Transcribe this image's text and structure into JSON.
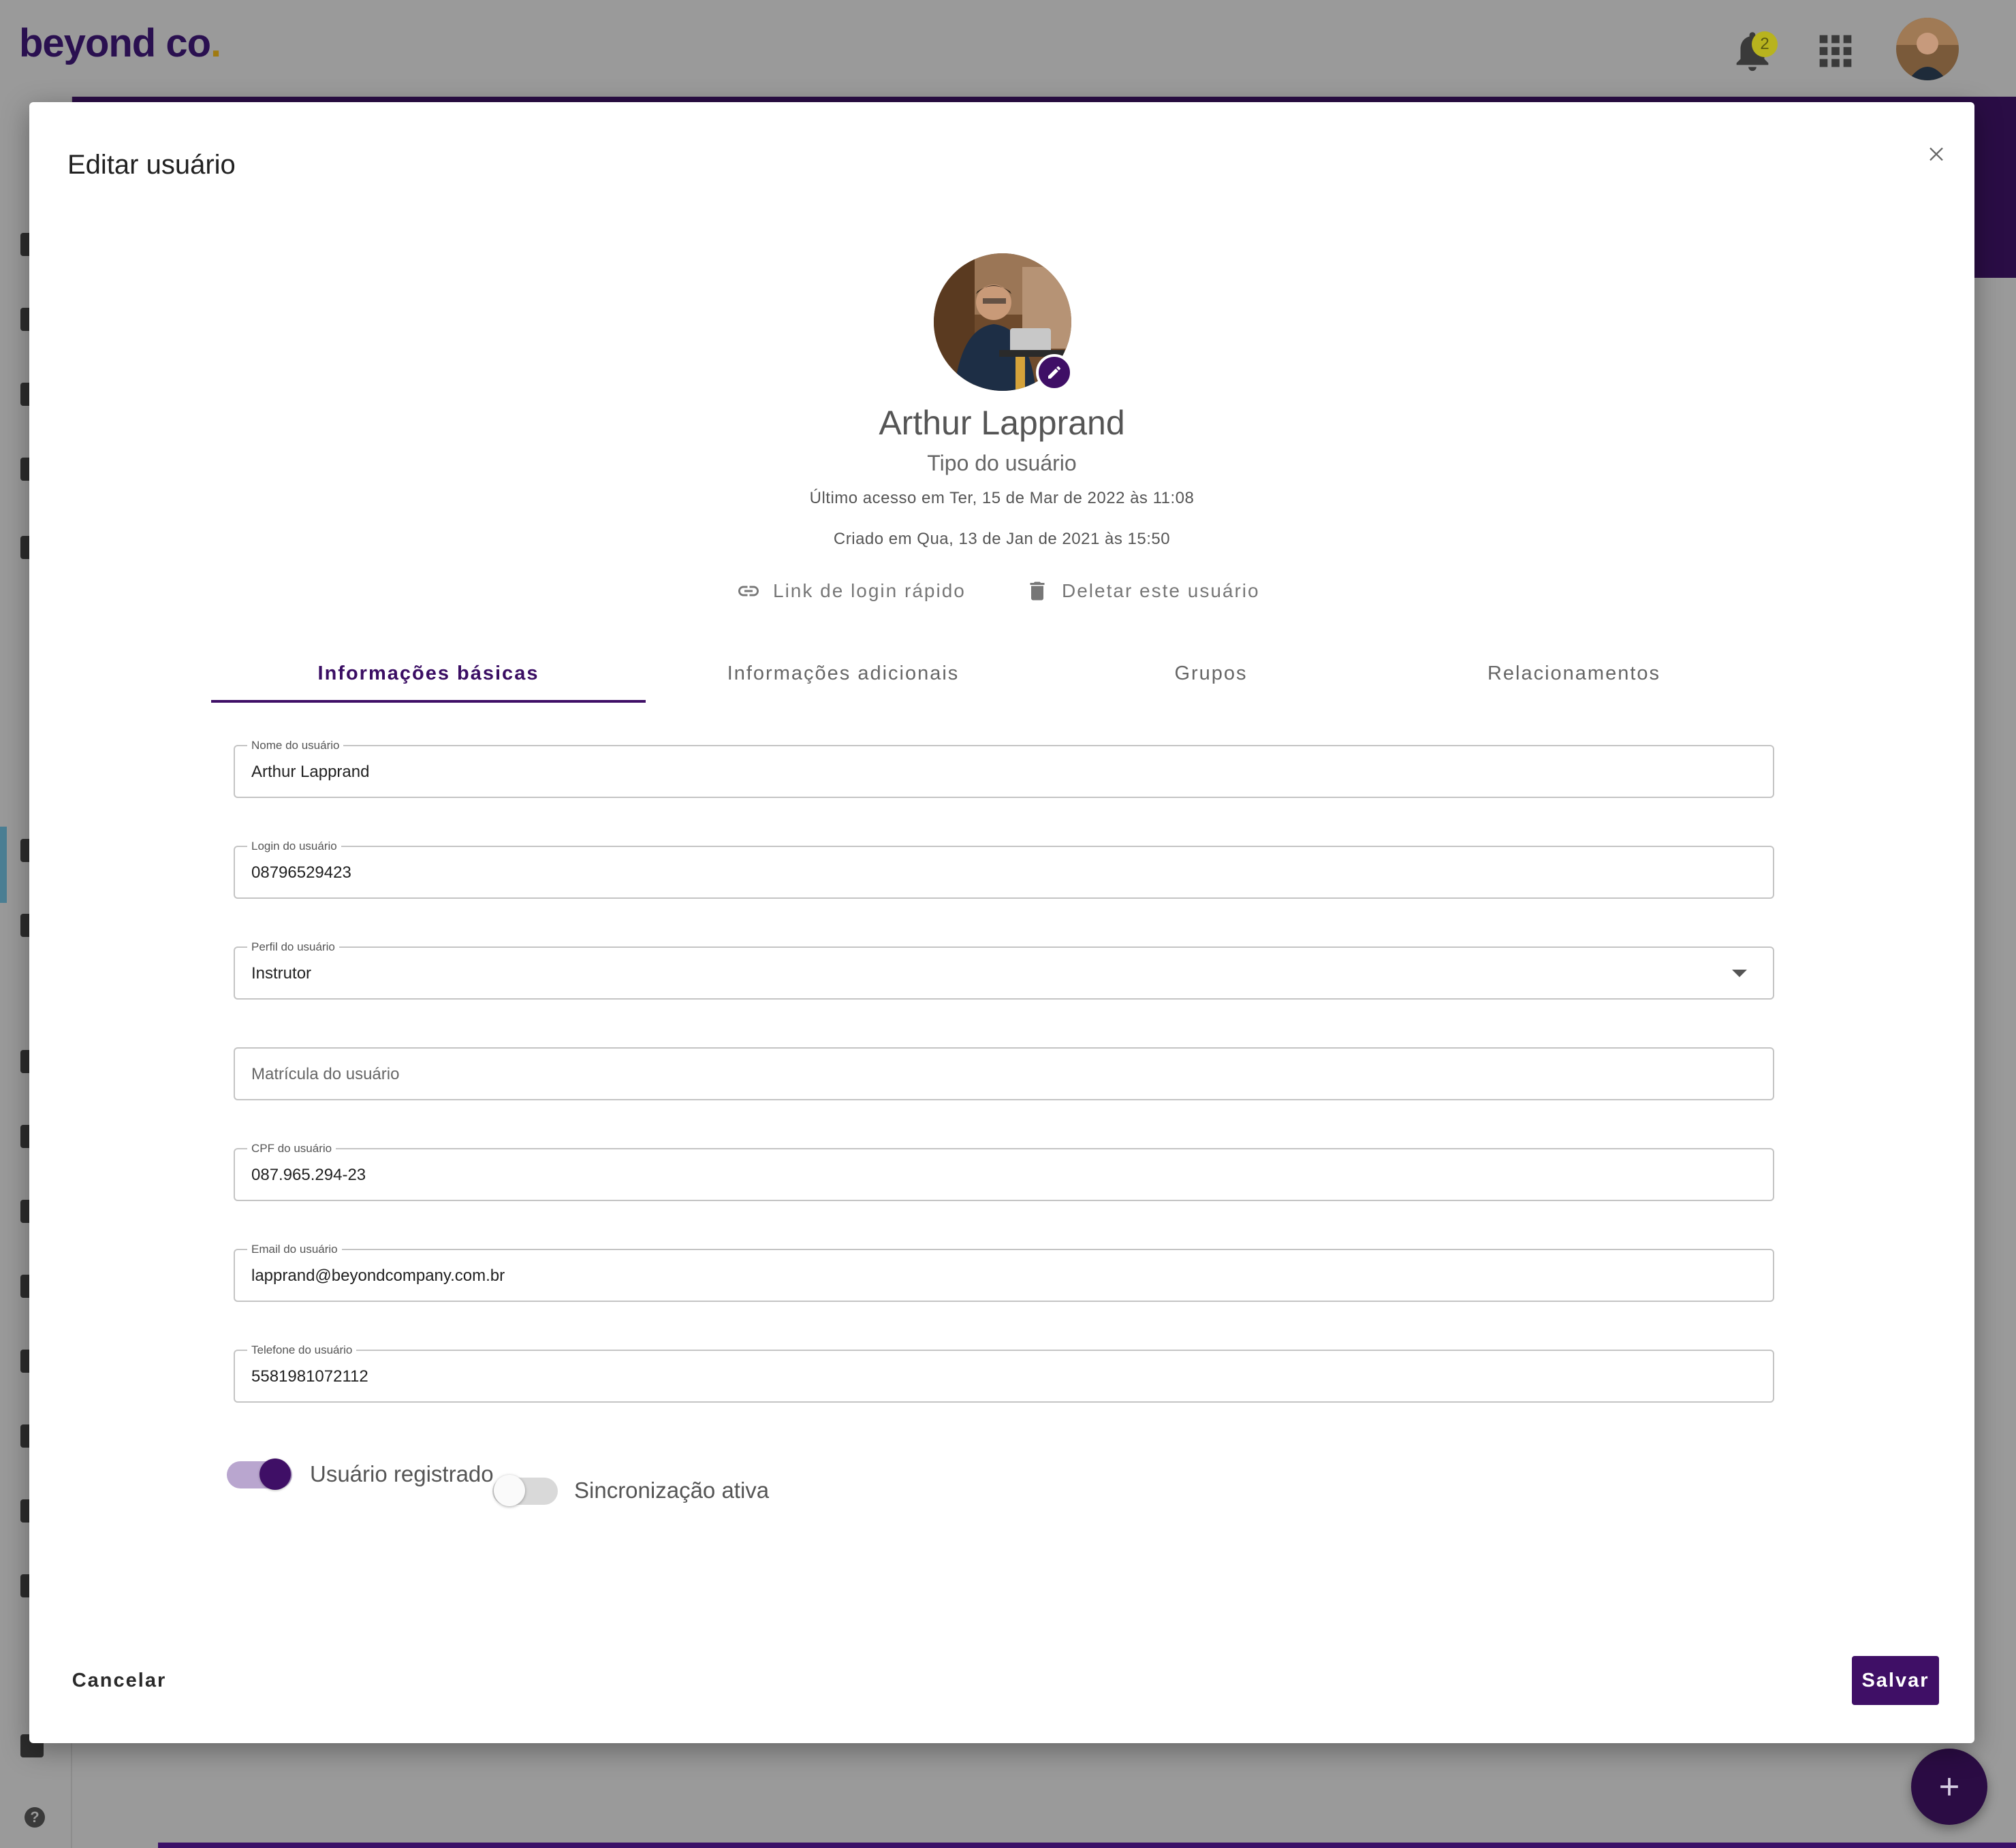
{
  "app": {
    "logo_text": "beyond co",
    "logo_dot": ".",
    "notifications_count": "2"
  },
  "modal": {
    "title": "Editar usuário",
    "user": {
      "name": "Arthur Lapprand",
      "type": "Tipo do usuário",
      "last_access": "Último acesso em Ter, 15 de Mar de 2022 às 11:08",
      "created": "Criado em Qua, 13 de Jan de 2021 às 15:50"
    },
    "actions": {
      "quick_login": "Link de login rápido",
      "delete_user": "Deletar este usuário"
    },
    "tabs": [
      {
        "label": "Informações básicas",
        "active": true
      },
      {
        "label": "Informações adicionais",
        "active": false
      },
      {
        "label": "Grupos",
        "active": false
      },
      {
        "label": "Relacionamentos",
        "active": false
      }
    ],
    "fields": {
      "name": {
        "label": "Nome do usuário",
        "value": "Arthur Lapprand"
      },
      "login": {
        "label": "Login do usuário",
        "value": "08796529423"
      },
      "profile": {
        "label": "Perfil do usuário",
        "value": "Instrutor"
      },
      "registration": {
        "placeholder": "Matrícula do usuário"
      },
      "cpf": {
        "label": "CPF do usuário",
        "value": "087.965.294-23"
      },
      "email": {
        "label": "Email do usuário",
        "value": "lapprand@beyondcompany.com.br"
      },
      "phone": {
        "label": "Telefone do usuário",
        "value": "5581981072112"
      }
    },
    "toggles": {
      "registered": {
        "label": "Usuário registrado",
        "on": true
      },
      "sync": {
        "label": "Sincronização ativa",
        "on": false
      }
    },
    "buttons": {
      "cancel": "Cancelar",
      "save": "Salvar"
    }
  },
  "colors": {
    "primary": "#3f0f66",
    "toggle_track_on": "#b9a6cf",
    "overlay": "#9a9a9a"
  },
  "icons": [
    "bell-icon",
    "apps-grid-icon",
    "close-icon",
    "edit-pencil-icon",
    "link-icon",
    "trash-icon",
    "dropdown-arrow-icon",
    "plus-icon",
    "help-icon"
  ]
}
